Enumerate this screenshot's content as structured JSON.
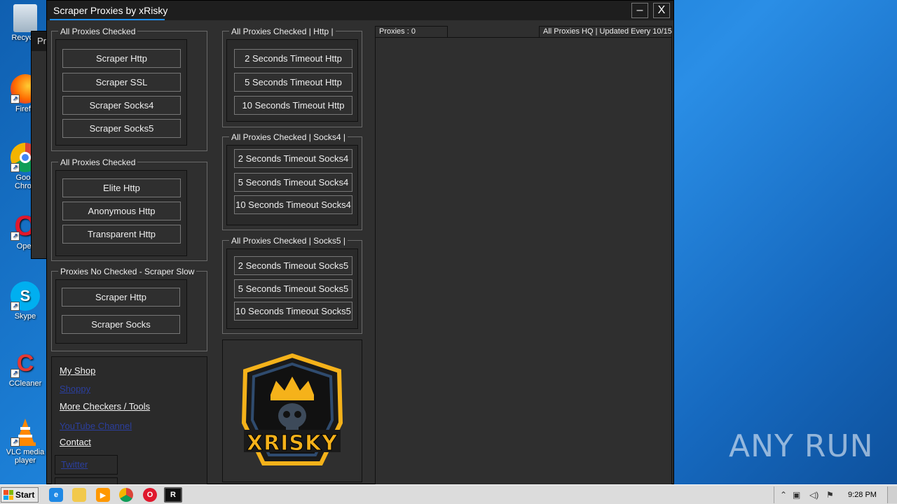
{
  "desktop": {
    "icons": [
      {
        "label": "Recycle",
        "icon": "recycle-bin-icon"
      },
      {
        "label": "Firefo",
        "icon": "firefox-icon"
      },
      {
        "label": "Goog Chron",
        "icon": "chrome-icon"
      },
      {
        "label": "Oper",
        "icon": "opera-icon"
      },
      {
        "label": "Skype",
        "icon": "skype-icon"
      },
      {
        "label": "CCleaner",
        "icon": "ccleaner-icon"
      },
      {
        "label": "VLC media player",
        "icon": "vlc-icon"
      }
    ],
    "watermark": "ANY RUN"
  },
  "background_window": {
    "title": "Pr"
  },
  "window": {
    "title": "Scraper Proxies by xRisky",
    "minimize": "–",
    "close": "X"
  },
  "groups": {
    "scraper": {
      "label": "All Proxies Checked",
      "buttons": [
        "Scraper Http",
        "Scraper SSL",
        "Scraper Socks4",
        "Scraper Socks5"
      ]
    },
    "anonymity": {
      "label": "All Proxies Checked",
      "buttons": [
        "Elite Http",
        "Anonymous Http",
        "Transparent Http"
      ]
    },
    "no_checked": {
      "label": "Proxies No Checked - Scraper Slow",
      "buttons": [
        "Scraper Http",
        "Scraper Socks"
      ]
    },
    "http": {
      "label": "All Proxies Checked | Http |",
      "buttons": [
        "2 Seconds Timeout Http",
        "5 Seconds Timeout Http",
        "10 Seconds Timeout Http"
      ]
    },
    "socks4": {
      "label": "All Proxies Checked | Socks4 |",
      "buttons": [
        "2 Seconds Timeout Socks4",
        "5 Seconds Timeout Socks4",
        "10 Seconds Timeout Socks4"
      ]
    },
    "socks5": {
      "label": "All Proxies Checked | Socks5 |",
      "buttons": [
        "2 Seconds Timeout Socks5",
        "5 Seconds Timeout Socks5",
        "10 Seconds Timeout Socks5"
      ]
    }
  },
  "links": {
    "my_shop": "My Shop",
    "shoppy": "Shoppy",
    "more_tools": "More Checkers / Tools",
    "youtube": "YouTube Channel",
    "contact": "Contact",
    "twitter": "Twitter"
  },
  "logo": {
    "text": "XRISKY"
  },
  "status": {
    "proxies_count": "Proxies : 0",
    "updated": "All Proxies HQ | Updated Every 10/15"
  },
  "taskbar": {
    "start": "Start",
    "clock": "9:28 PM",
    "apps": [
      "internet-explorer-icon",
      "folder-icon",
      "media-player-icon",
      "chrome-icon",
      "opera-icon",
      "xrisky-app-icon"
    ]
  },
  "colors": {
    "window_bg": "#2f2f2f",
    "titlebar_bg": "#1e1e1e",
    "title_accent": "#1e90ff",
    "logo_yellow": "#f5b21a",
    "desktop_blue": "#1c7fd6"
  }
}
